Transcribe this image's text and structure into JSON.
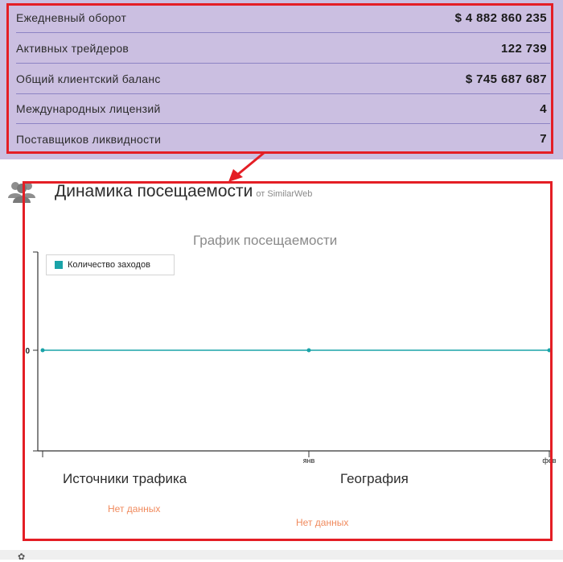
{
  "stats": {
    "rows": [
      {
        "label": "Ежедневный оборот",
        "value": "$ 4 882 860 235"
      },
      {
        "label": "Активных трейдеров",
        "value": "122 739"
      },
      {
        "label": "Общий клиентский баланс",
        "value": "$ 745 687 687"
      },
      {
        "label": "Международных лицензий",
        "value": "4"
      },
      {
        "label": "Поставщиков ликвидности",
        "value": "7"
      }
    ]
  },
  "colors": {
    "panel_bg": "#cbbfe1",
    "highlight": "#e41e25",
    "series": "#1aa3a8",
    "no_data": "#f08a5d"
  },
  "traffic": {
    "icon": "users-icon",
    "title": "Динамика посещаемости",
    "source": "от SimilarWeb"
  },
  "chart_data": {
    "type": "line",
    "title": "График посещаемости",
    "xlabel": "",
    "ylabel": "",
    "categories": [
      "",
      "янв",
      "фев"
    ],
    "series": [
      {
        "name": "Количество заходов",
        "values": [
          0,
          0,
          0
        ]
      }
    ],
    "y_ticks": [
      "0"
    ],
    "legend": "top-left",
    "grid": false
  },
  "sections": {
    "sources": {
      "heading": "Источники трафика",
      "empty": "Нет данных"
    },
    "geo": {
      "heading": "География",
      "empty": "Нет данных"
    }
  }
}
